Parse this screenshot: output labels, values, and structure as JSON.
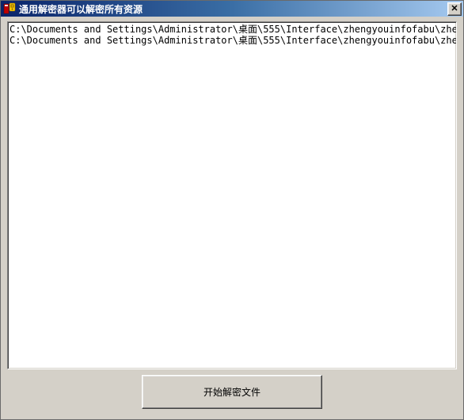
{
  "window": {
    "title": "通用解密器可以解密所有资源"
  },
  "list": {
    "lines": [
      "C:\\Documents and Settings\\Administrator\\桌面\\555\\Interface\\zhengyouinfofabu\\zhengyouinfofabu.",
      "C:\\Documents and Settings\\Administrator\\桌面\\555\\Interface\\zhengyouinfofabu\\zhengyouinfofabu."
    ]
  },
  "buttons": {
    "start_label": "开始解密文件",
    "close_glyph": "✕"
  }
}
